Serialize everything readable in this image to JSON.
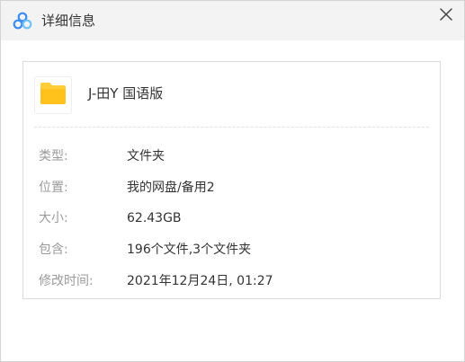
{
  "dialog": {
    "title": "详细信息",
    "close_label": "×"
  },
  "file": {
    "name": "J-田Y 国语版",
    "icon": "folder-icon"
  },
  "details": [
    {
      "label": "类型:",
      "value": "文件夹"
    },
    {
      "label": "位置:",
      "value": "我的网盘/备用2"
    },
    {
      "label": "大小:",
      "value": "62.43GB"
    },
    {
      "label": "包含:",
      "value": "196个文件,3个文件夹"
    },
    {
      "label": "修改时间:",
      "value": "2021年12月24日, 01:27"
    }
  ],
  "colors": {
    "titlebar": "#f3f3f3",
    "folder": "#ffcd38",
    "label": "#9a9a9a",
    "text": "#333333",
    "logo_blue": "#3b8cf5",
    "logo_light": "#6fc3f7"
  }
}
